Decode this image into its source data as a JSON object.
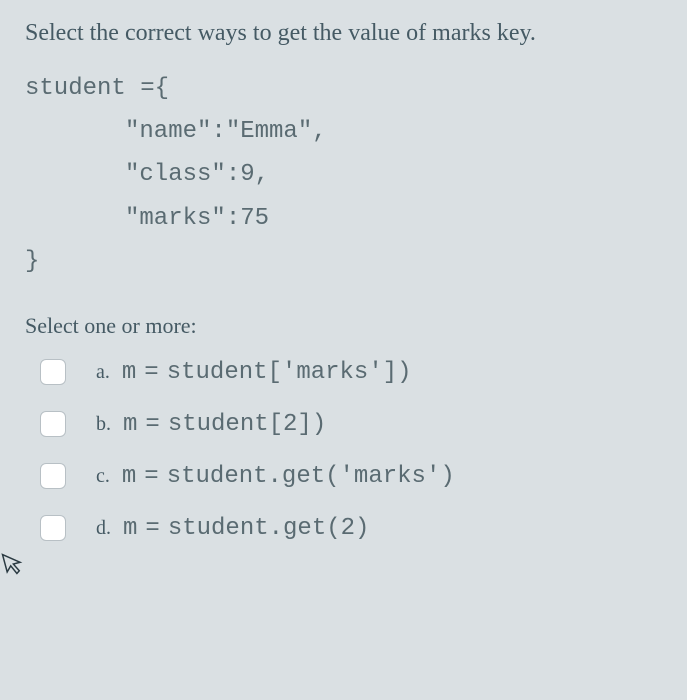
{
  "question": {
    "title": "Select the correct ways to get the value of marks key.",
    "code_lines": [
      "student ={",
      "\"name\":\"Emma\",",
      "\"class\":9,",
      "\"marks\":75",
      "}"
    ]
  },
  "prompt": "Select one or more:",
  "options": [
    {
      "label": "a.",
      "var": "m",
      "eq": "=",
      "code": "student['marks'])"
    },
    {
      "label": "b.",
      "var": "m",
      "eq": "=",
      "code": "student[2])"
    },
    {
      "label": "c.",
      "var": "m",
      "eq": "=",
      "code": "student.get('marks')"
    },
    {
      "label": "d.",
      "var": "m",
      "eq": "=",
      "code": "student.get(2)"
    }
  ]
}
